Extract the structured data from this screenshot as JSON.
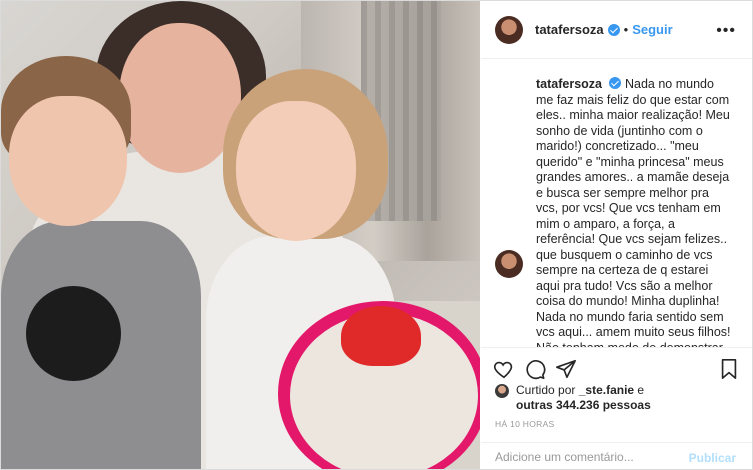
{
  "post": {
    "username": "tatafersoza",
    "separator": "•",
    "follow_label": "Seguir",
    "more_label": "•••",
    "caption_username": "tatafersoza",
    "caption": "Nada no mundo me faz mais feliz do que estar com eles.. minha maior realização! Meu sonho de vida (juntinho com o marido!) concretizado... \"meu querido\" e \"minha princesa\" meus grandes amores.. a mamãe deseja e busca ser sempre melhor pra vcs, por vcs! Que vcs tenham em mim o amparo, a força, a referência! Que vcs sejam felizes.. que busquem o caminho de vcs sempre na certeza de q estarei aqui pra tudo! Vcs são a melhor coisa do mundo! Minha duplinha! Nada no mundo faria sentido sem vcs aqui... amem muito seus filhos! Não tenham medo de demonstrar amor.. agarra msm! Cheira msm! Beija msm!!!! FELIZ DIA DAS MÃES! Senhor,",
    "liked_by_prefix": "Curtido por",
    "liked_by_user": "_ste.fanie",
    "liked_by_and": "e",
    "likes_count_text": "outras 344.236 pessoas",
    "time_ago": "HÁ 10 HORAS",
    "comment_placeholder": "Adicione um comentário...",
    "publish_label": "Publicar"
  },
  "icons": {
    "like": "heart-icon",
    "comment": "comment-icon",
    "share": "share-icon",
    "save": "bookmark-icon",
    "verified": "verified-badge-icon"
  },
  "colors": {
    "link_blue": "#3897f0",
    "verified_blue": "#3897f0",
    "muted_gray": "#999999",
    "publish_disabled": "#b2dffc"
  }
}
